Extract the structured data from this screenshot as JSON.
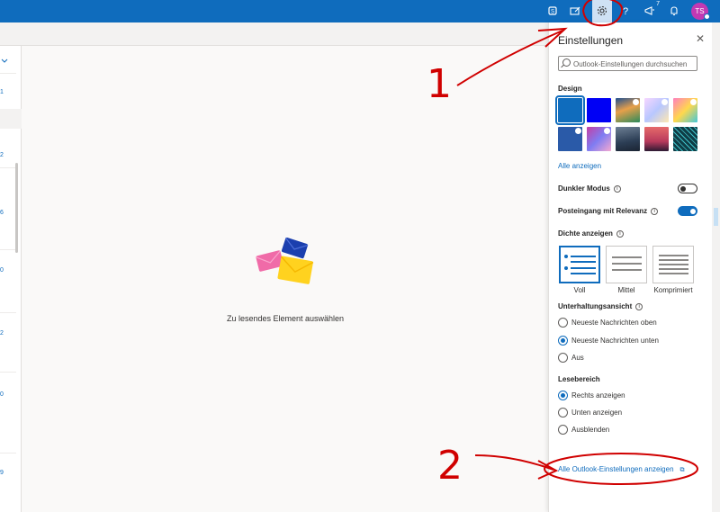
{
  "topbar": {
    "badge_count": "7",
    "avatar_initials": "TS",
    "accent_color": "#0f6cbd",
    "icons": [
      "teams-icon",
      "compose-icon",
      "settings-gear-icon",
      "help-icon",
      "megaphone-icon",
      "bell-icon"
    ]
  },
  "reading_pane": {
    "empty_text": "Zu lesendes Element auswählen"
  },
  "left_list": {
    "fragments": [
      "1",
      "2",
      "6",
      "0",
      "2",
      "0",
      "9"
    ]
  },
  "settings": {
    "title": "Einstellungen",
    "search_placeholder": "Outlook-Einstellungen durchsuchen",
    "design_label": "Design",
    "show_all_label": "Alle anzeigen",
    "dark_mode_label": "Dunkler Modus",
    "dark_mode_on": false,
    "focused_inbox_label": "Posteingang mit Relevanz",
    "focused_inbox_on": true,
    "density_label": "Dichte anzeigen",
    "density_options": [
      "Voll",
      "Mittel",
      "Komprimiert"
    ],
    "density_selected": "Voll",
    "conversation_label": "Unterhaltungsansicht",
    "conversation_options": [
      "Neueste Nachrichten oben",
      "Neueste Nachrichten unten",
      "Aus"
    ],
    "conversation_selected": "Neueste Nachrichten unten",
    "reading_label": "Lesebereich",
    "reading_options": [
      "Rechts anzeigen",
      "Unten anzeigen",
      "Ausblenden"
    ],
    "reading_selected": "Rechts anzeigen",
    "all_settings_link": "Alle Outlook-Einstellungen anzeigen"
  },
  "annotations": {
    "label_1": "1",
    "label_2": "2",
    "color": "#d00000"
  }
}
